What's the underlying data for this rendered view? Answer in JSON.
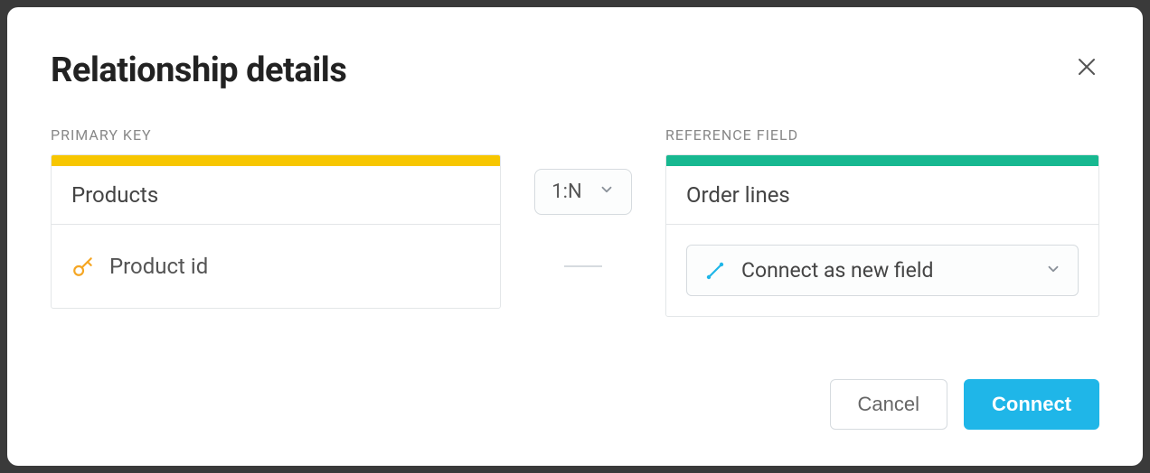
{
  "dialog": {
    "title": "Relationship details"
  },
  "labels": {
    "primary_key": "PRIMARY KEY",
    "reference_field": "REFERENCE FIELD"
  },
  "primary": {
    "table_name": "Products",
    "field_name": "Product id",
    "accent_color": "#f7c600"
  },
  "reference": {
    "table_name": "Order lines",
    "field_select_label": "Connect as new field",
    "accent_color": "#17b890"
  },
  "cardinality": {
    "value": "1:N"
  },
  "buttons": {
    "cancel": "Cancel",
    "connect": "Connect"
  }
}
